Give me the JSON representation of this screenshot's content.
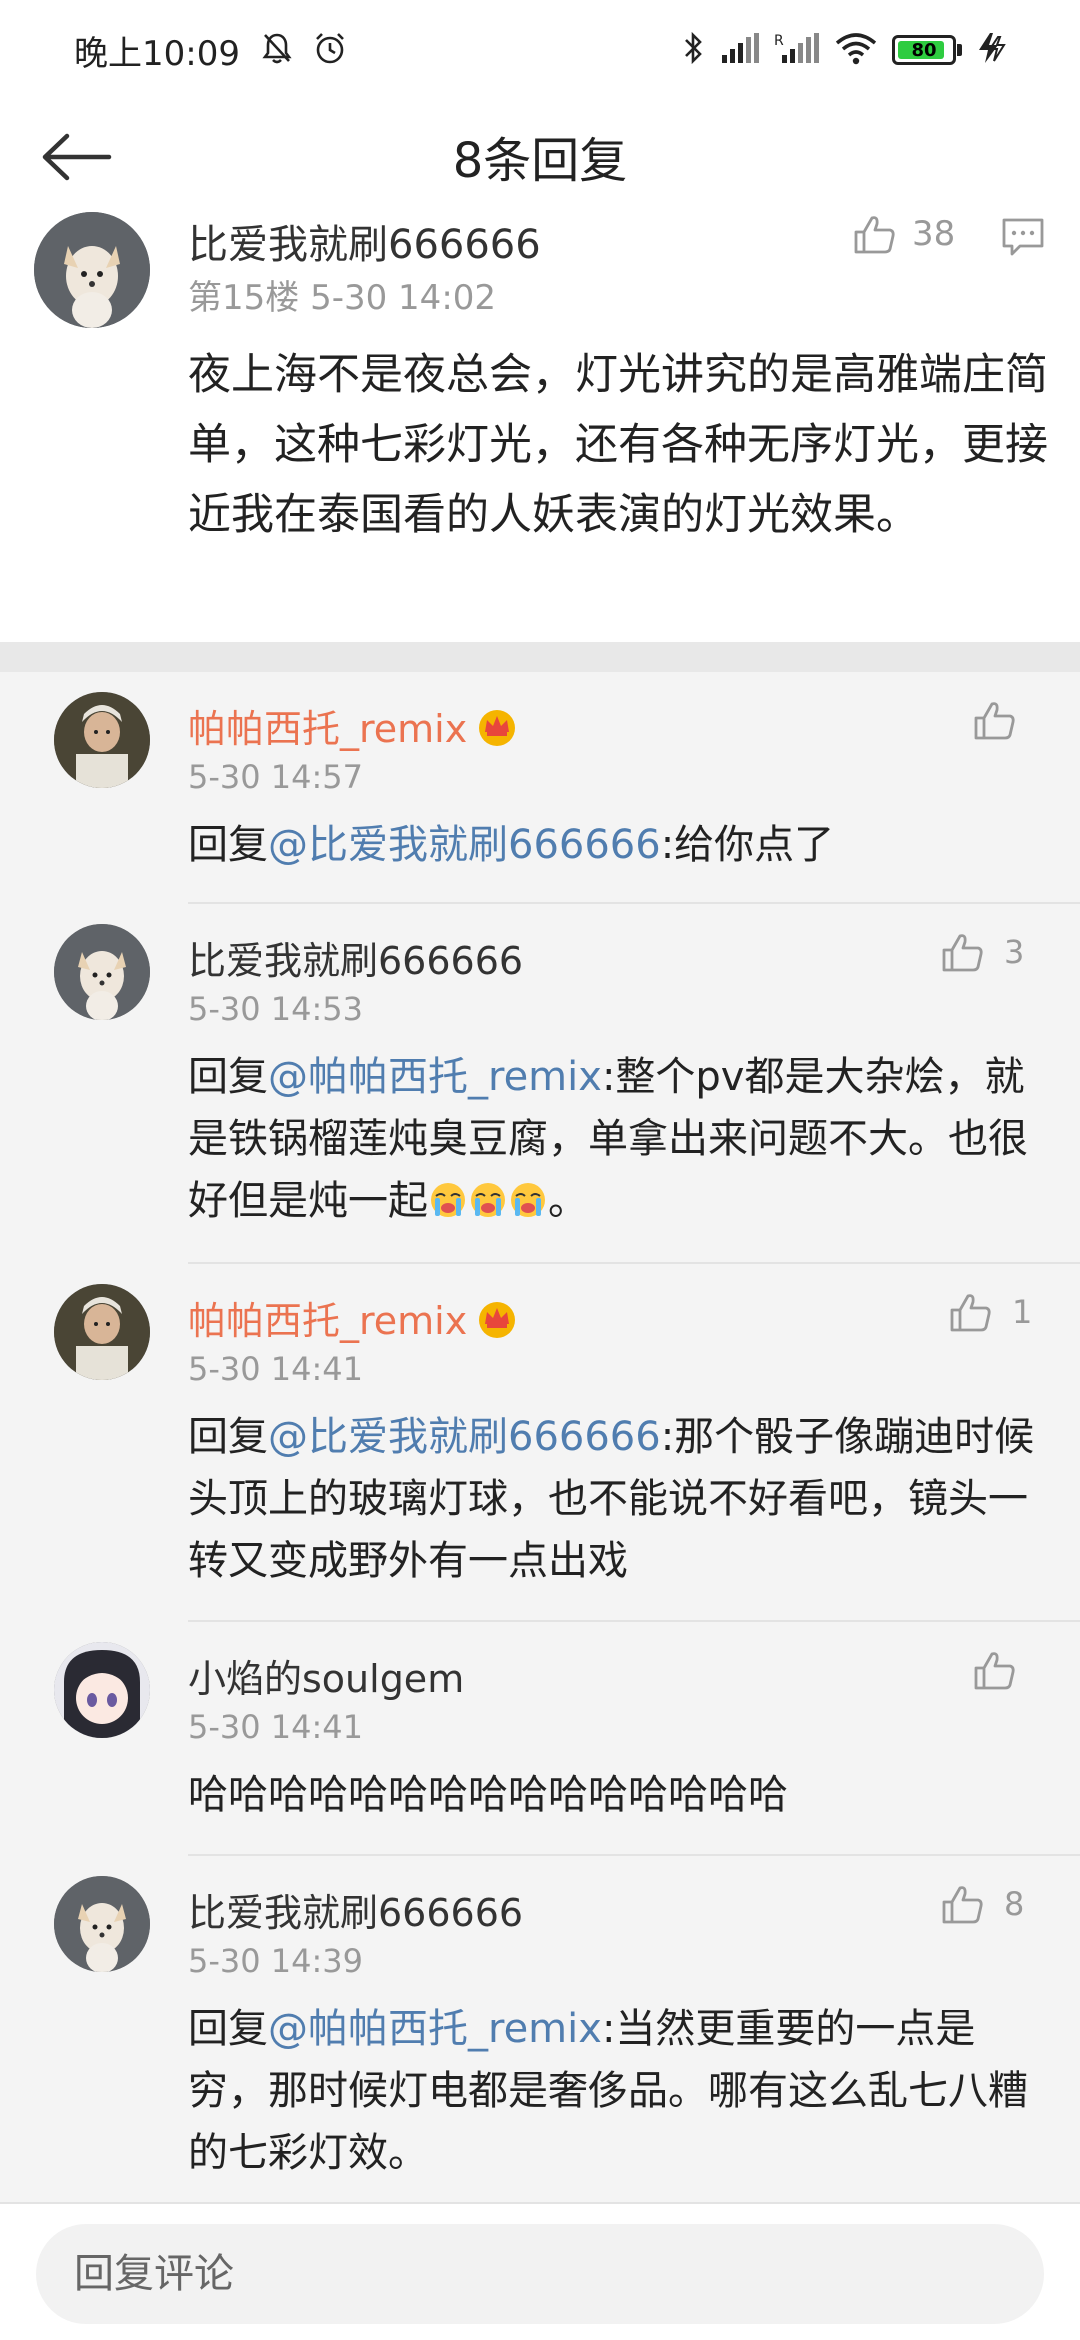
{
  "status_bar": {
    "time": "晚上10:09",
    "battery": "80",
    "icons": [
      "mute-bell-icon",
      "alarm-icon",
      "bluetooth-icon",
      "signal-icon",
      "signal-roaming-icon",
      "wifi-icon",
      "battery-icon",
      "charging-icon"
    ]
  },
  "nav": {
    "title": "8条回复",
    "back_icon": "back-arrow-icon"
  },
  "main_comment": {
    "username": "比爱我就刷666666",
    "floor": "第15楼",
    "timestamp": "5-30 14:02",
    "like_count": "38",
    "text": "夜上海不是夜总会，灯光讲究的是高雅端庄简单，这种七彩灯光，还有各种无序灯光，更接近我在泰国看的人妖表演的灯光效果。"
  },
  "replies": [
    {
      "username": "帕帕西托_remix",
      "vip": true,
      "time": "5-30 14:57",
      "like_count": "",
      "prefix": "回复",
      "mention": "@比爱我就刷666666",
      "text": ":给你点了"
    },
    {
      "username": "比爱我就刷666666",
      "vip": false,
      "time": "5-30 14:53",
      "like_count": "3",
      "prefix": "回复",
      "mention": "@帕帕西托_remix",
      "text": ":整个pv都是大杂烩，就是铁锅榴莲炖臭豆腐，单拿出来问题不大。也很好但是炖一起",
      "suffix": "。"
    },
    {
      "username": "帕帕西托_remix",
      "vip": true,
      "time": "5-30 14:41",
      "like_count": "1",
      "prefix": "回复",
      "mention": "@比爱我就刷666666",
      "text": ":那个骰子像蹦迪时候头顶上的玻璃灯球，也不能说不好看吧，镜头一转又变成野外有一点出戏"
    },
    {
      "username": "小焰的soulgem",
      "vip": false,
      "time": "5-30 14:41",
      "like_count": "",
      "text": "哈哈哈哈哈哈哈哈哈哈哈哈哈哈哈"
    },
    {
      "username": "比爱我就刷666666",
      "vip": false,
      "time": "5-30 14:39",
      "like_count": "8",
      "prefix": "回复",
      "mention": "@帕帕西托_remix",
      "text": ":当然更重要的一点是穷，那时候灯电都是奢侈品。哪有这么乱七八糟的七彩灯效。"
    }
  ],
  "bottom_bar": {
    "placeholder": "回复评论"
  },
  "colors": {
    "vip_name": "#eb7350",
    "mention": "#507daf",
    "meta": "#999999"
  }
}
